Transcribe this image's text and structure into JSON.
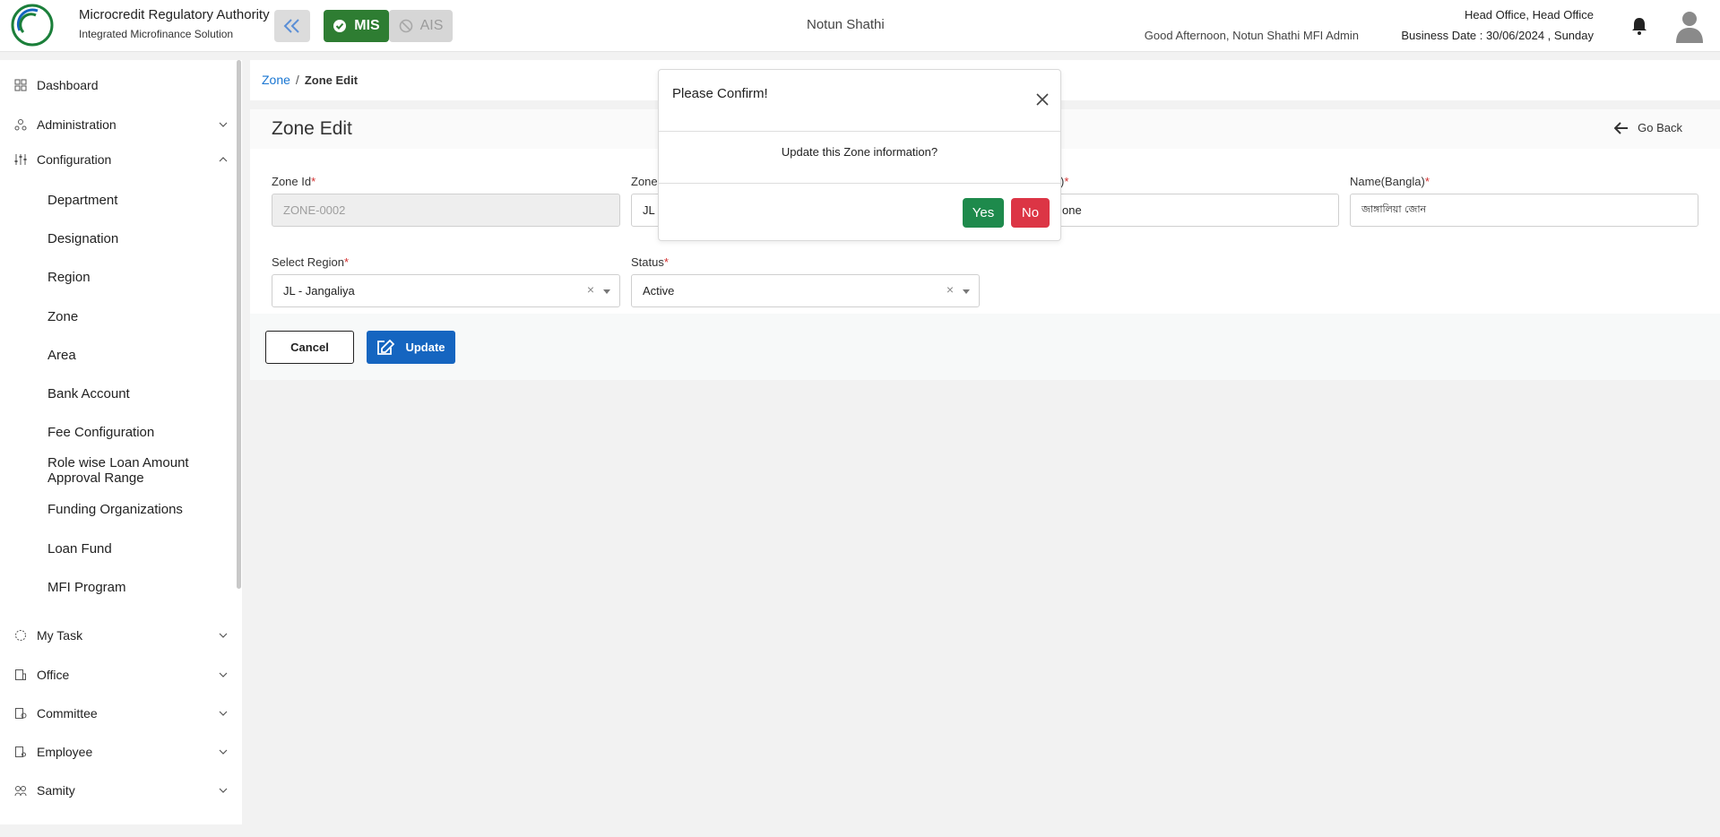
{
  "header": {
    "brand_title": "Microcredit Regulatory Authority",
    "brand_subtitle": "Integrated Microfinance Solution",
    "logo_text": "Microcredit Regulatory Authority",
    "mis_label": "MIS",
    "ais_label": "AIS",
    "center_title": "Notun Shathi",
    "greeting": "Good Afternoon, Notun Shathi MFI Admin",
    "office": "Head Office, Head Office",
    "business_date": "Business Date : 30/06/2024 , Sunday",
    "accent": "#2e7d32"
  },
  "sidebar": {
    "dashboard": "Dashboard",
    "administration": "Administration",
    "configuration": "Configuration",
    "config_items": [
      "Department",
      "Designation",
      "Region",
      "Zone",
      "Area",
      "Bank Account",
      "Fee Configuration",
      "Role wise Loan Amount Approval Range",
      "Funding Organizations",
      "Loan Fund",
      "MFI Program"
    ],
    "my_task": "My Task",
    "office": "Office",
    "committee": "Committee",
    "employee": "Employee",
    "samity": "Samity"
  },
  "breadcrumb": {
    "parent": "Zone",
    "separator": "/",
    "current": "Zone Edit"
  },
  "page": {
    "title": "Zone Edit",
    "go_back": "Go Back"
  },
  "form": {
    "zone_id_label": "Zone Id",
    "zone_id_value": "ZONE-0002",
    "zone_code_label": "Zone",
    "zone_code_value": "JL",
    "name_en_label": ")",
    "name_en_value": "one",
    "name_bn_label": "Name(Bangla)",
    "name_bn_value": "জাঙ্গালিয়া জোন",
    "region_label": "Select Region",
    "region_value": "JL - Jangaliya",
    "status_label": "Status",
    "status_value": "Active",
    "required_mark": "*",
    "clear_mark": "×"
  },
  "actions": {
    "cancel": "Cancel",
    "update": "Update"
  },
  "modal": {
    "title": "Please Confirm!",
    "message": "Update this Zone information?",
    "yes": "Yes",
    "no": "No"
  }
}
